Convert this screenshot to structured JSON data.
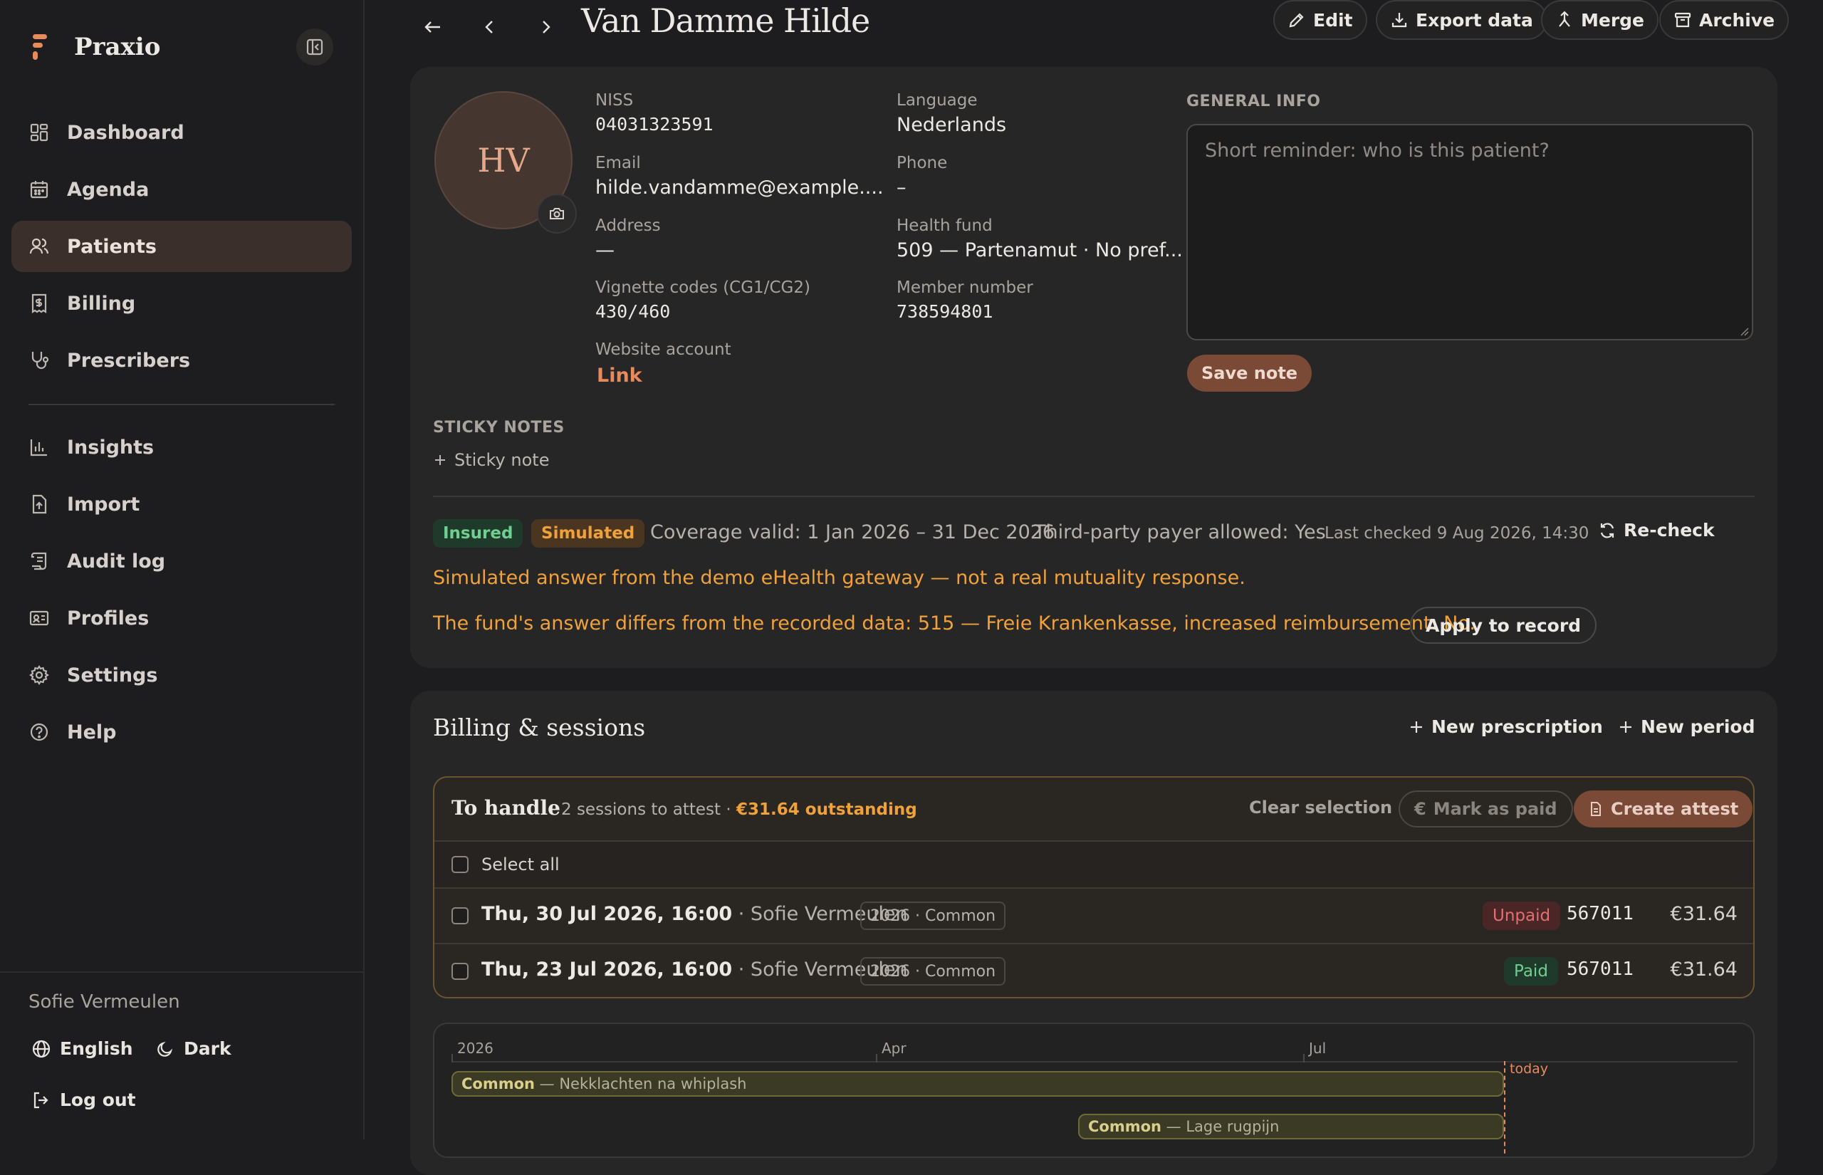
{
  "app": {
    "name": "Praxio"
  },
  "sidebar": {
    "items": [
      {
        "label": "Dashboard",
        "icon": "dashboard-icon"
      },
      {
        "label": "Agenda",
        "icon": "calendar-icon"
      },
      {
        "label": "Patients",
        "icon": "users-icon",
        "active": true
      },
      {
        "label": "Billing",
        "icon": "receipt-icon"
      },
      {
        "label": "Prescribers",
        "icon": "stethoscope-icon"
      }
    ],
    "items2": [
      {
        "label": "Insights",
        "icon": "bar-chart-icon"
      },
      {
        "label": "Import",
        "icon": "file-upload-icon"
      },
      {
        "label": "Audit log",
        "icon": "scroll-icon"
      },
      {
        "label": "Profiles",
        "icon": "id-card-icon"
      },
      {
        "label": "Settings",
        "icon": "gear-icon"
      },
      {
        "label": "Help",
        "icon": "help-circle-icon"
      }
    ],
    "user": "Sofie Vermeulen",
    "language": "English",
    "theme": "Dark",
    "logout": "Log out"
  },
  "header": {
    "title": "Van Damme Hilde",
    "edit": "Edit",
    "export": "Export data",
    "merge": "Merge",
    "archive": "Archive"
  },
  "patient": {
    "initials": "HV",
    "niss_label": "NISS",
    "niss": "04031323591",
    "language_label": "Language",
    "language": "Nederlands",
    "email_label": "Email",
    "email": "hilde.vandamme@example....",
    "phone_label": "Phone",
    "phone": "–",
    "address_label": "Address",
    "address": "—",
    "fund_label": "Health fund",
    "fund": "509 — Partenamut · No pref...",
    "vignette_label": "Vignette codes (CG1/CG2)",
    "vignette": "430/460",
    "member_label": "Member number",
    "member": "738594801",
    "website_label": "Website account",
    "website_link": "Link",
    "general_info_label": "GENERAL INFO",
    "note_placeholder": "Short reminder: who is this patient?",
    "save_note": "Save note",
    "sticky_label": "STICKY NOTES",
    "sticky_add": "Sticky note"
  },
  "insurance": {
    "badge_insured": "Insured",
    "badge_simulated": "Simulated",
    "coverage": "Coverage valid: 1 Jan 2026 – 31 Dec 2026",
    "third_party": "Third-party payer allowed: Yes",
    "last_checked": "Last checked 9 Aug 2026, 14:30",
    "recheck": "Re-check",
    "simulated_msg": "Simulated answer from the demo eHealth gateway — not a real mutuality response.",
    "diff_msg": "The fund's answer differs from the recorded data: 515 — Freie Krankenkasse, increased reimbursement: No.",
    "apply": "Apply to record",
    "colors": {
      "insured": "#6fcf8f",
      "simulated": "#f0a13a",
      "warning": "#f0a13a"
    }
  },
  "billing": {
    "title": "Billing & sessions",
    "new_prescription": "New prescription",
    "new_period": "New period",
    "to_handle": {
      "title": "To handle",
      "summary": "2 sessions to attest ·",
      "outstanding": "€31.64 outstanding",
      "clear": "Clear selection",
      "mark_paid": "Mark as paid",
      "create_attest": "Create attest",
      "select_all": "Select all",
      "rows": [
        {
          "date": "Thu, 30 Jul 2026, 16:00",
          "who": "· Sofie Vermeulen",
          "tag": "2026 · Common",
          "status": "Unpaid",
          "code": "567011",
          "amount": "€31.64"
        },
        {
          "date": "Thu, 23 Jul 2026, 16:00",
          "who": "· Sofie Vermeulen",
          "tag": "2026 · Common",
          "status": "Paid",
          "code": "567011",
          "amount": "€31.64"
        }
      ]
    },
    "timeline": {
      "months": [
        "2026",
        "Apr",
        "Jul"
      ],
      "today": "today",
      "bars": [
        {
          "kind": "Common",
          "desc": "— Nekklachten na whiplash"
        },
        {
          "kind": "Common",
          "desc": "— Lage rugpijn"
        }
      ]
    }
  }
}
